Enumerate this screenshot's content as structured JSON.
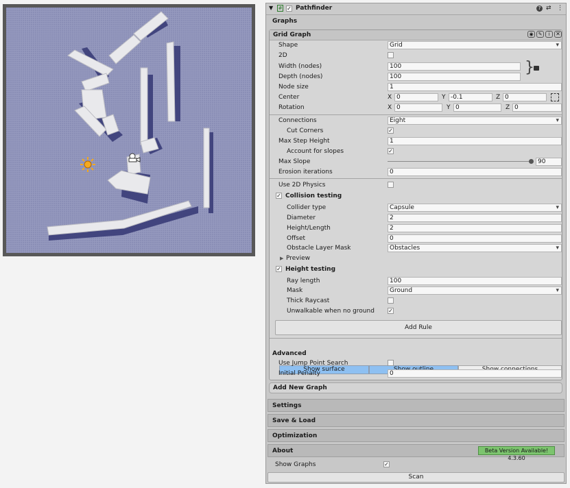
{
  "inspector": {
    "title": "Pathfinder",
    "header_icons": [
      "help-icon",
      "settings-sliders-icon",
      "more-icon"
    ],
    "graphs_label": "Graphs",
    "grid_graph": {
      "title": "Grid Graph",
      "shape_label": "Shape",
      "shape_value": "Grid",
      "two_d_label": "2D",
      "width_label": "Width (nodes)",
      "width_value": "100",
      "depth_label": "Depth (nodes)",
      "depth_value": "100",
      "node_size_label": "Node size",
      "node_size_value": "1",
      "center_label": "Center",
      "center": {
        "x_axis": "X",
        "x": "0",
        "y_axis": "Y",
        "y": "-0.1",
        "z_axis": "Z",
        "z": "0"
      },
      "rotation_label": "Rotation",
      "rotation": {
        "x_axis": "X",
        "x": "0",
        "y_axis": "Y",
        "y": "0",
        "z_axis": "Z",
        "z": "0"
      },
      "connections_label": "Connections",
      "connections_value": "Eight",
      "cut_corners_label": "Cut Corners",
      "cut_corners_check": "✓",
      "max_step_label": "Max Step Height",
      "max_step_value": "1",
      "account_slopes_label": "Account for slopes",
      "account_slopes_check": "✓",
      "max_slope_label": "Max Slope",
      "max_slope_value": "90",
      "max_slope_fraction": 1.0,
      "erosion_label": "Erosion iterations",
      "erosion_value": "0",
      "use_2d_physics_label": "Use 2D Physics",
      "collision_label": "Collision testing",
      "collision_check": "✓",
      "collider_type_label": "Collider type",
      "collider_type_value": "Capsule",
      "diameter_label": "Diameter",
      "diameter_value": "2",
      "height_length_label": "Height/Length",
      "height_length_value": "2",
      "offset_label": "Offset",
      "offset_value": "0",
      "obstacle_mask_label": "Obstacle Layer Mask",
      "obstacle_mask_value": "Obstacles",
      "preview_label": "Preview",
      "height_testing_label": "Height testing",
      "height_testing_check": "✓",
      "ray_length_label": "Ray length",
      "ray_length_value": "100",
      "mask_label": "Mask",
      "mask_value": "Ground",
      "thick_raycast_label": "Thick Raycast",
      "unwalkable_label": "Unwalkable when no ground",
      "unwalkable_check": "✓",
      "add_rule_label": "Add Rule",
      "show_surface_label": "Show surface",
      "show_outline_label": "Show outline",
      "show_connections_label": "Show connections",
      "advanced_label": "Advanced",
      "jump_point_label": "Use Jump Point Search",
      "initial_penalty_label": "Initial Penalty",
      "initial_penalty_value": "0"
    },
    "add_new_graph_label": "Add New Graph",
    "settings_label": "Settings",
    "save_load_label": "Save & Load",
    "optimization_label": "Optimization",
    "about_label": "About",
    "beta_badge": "Beta Version Available! 4.3.60",
    "show_graphs_label": "Show Graphs",
    "show_graphs_check": "✓",
    "scan_label": "Scan"
  },
  "colors": {
    "grid_fill": "#8f93b8",
    "obstacle_top": "#e9e9ec",
    "obstacle_shadow": "#3a3d78",
    "toggle_active": "#8ec0f2",
    "beta_badge": "#7cc46e"
  }
}
